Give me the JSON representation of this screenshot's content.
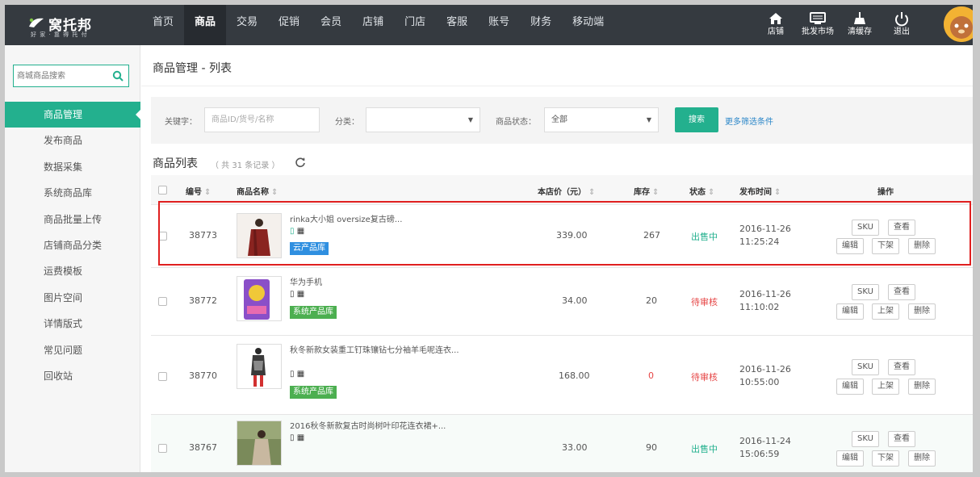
{
  "header": {
    "logo_name": "窝托邦",
    "logo_slogan": "好 家 · 靠 得 托 付",
    "nav": [
      {
        "label": "首页",
        "active": false
      },
      {
        "label": "商品",
        "active": true
      },
      {
        "label": "交易",
        "active": false
      },
      {
        "label": "促销",
        "active": false
      },
      {
        "label": "会员",
        "active": false
      },
      {
        "label": "店铺",
        "active": false
      },
      {
        "label": "门店",
        "active": false
      },
      {
        "label": "客服",
        "active": false
      },
      {
        "label": "账号",
        "active": false
      },
      {
        "label": "财务",
        "active": false
      },
      {
        "label": "移动端",
        "active": false
      }
    ],
    "tools": [
      {
        "label": "店铺",
        "icon": "home-icon"
      },
      {
        "label": "批发市场",
        "icon": "monitor-icon"
      },
      {
        "label": "清缓存",
        "icon": "broom-icon"
      },
      {
        "label": "退出",
        "icon": "power-icon"
      }
    ]
  },
  "sidebar": {
    "search_placeholder": "商城商品搜索",
    "items": [
      {
        "label": "商品管理",
        "active": true
      },
      {
        "label": "发布商品",
        "active": false
      },
      {
        "label": "数据采集",
        "active": false
      },
      {
        "label": "系统商品库",
        "active": false
      },
      {
        "label": "商品批量上传",
        "active": false
      },
      {
        "label": "店铺商品分类",
        "active": false
      },
      {
        "label": "运费模板",
        "active": false
      },
      {
        "label": "图片空间",
        "active": false
      },
      {
        "label": "详情版式",
        "active": false
      },
      {
        "label": "常见问题",
        "active": false
      },
      {
        "label": "回收站",
        "active": false
      }
    ]
  },
  "main": {
    "title": "商品管理 - 列表",
    "filter": {
      "keyword_label": "关键字：",
      "keyword_placeholder": "商品ID/货号/名称",
      "category_label": "分类：",
      "category_value": "",
      "status_label": "商品状态：",
      "status_value": "全部",
      "search_button": "搜索",
      "more_filters": "更多筛选条件"
    },
    "list_title": "商品列表",
    "list_count": "（ 共 31 条记录 ）",
    "columns": {
      "id": "编号",
      "name": "商品名称",
      "price": "本店价（元）",
      "stock": "库存",
      "status": "状态",
      "time": "发布时间",
      "ops": "操作"
    },
    "rows": [
      {
        "id": "38773",
        "name": "rinka大小姐 oversize复古磅...",
        "tag": "云产品库",
        "price": "339.00",
        "stock": "267",
        "status": "出售中",
        "date": "2016-11-26",
        "time": "11:25:24",
        "ops": [
          "SKU",
          "查看",
          "编辑",
          "下架",
          "删除"
        ]
      },
      {
        "id": "38772",
        "name": "华为手机",
        "tag": "系统产品库",
        "price": "34.00",
        "stock": "20",
        "status": "待审核",
        "date": "2016-11-26",
        "time": "11:10:02",
        "ops": [
          "SKU",
          "查看",
          "编辑",
          "上架",
          "删除"
        ]
      },
      {
        "id": "38770",
        "name": "秋冬新款女装重工钉珠镶钻七分袖羊毛呢连衣...",
        "tag": "系统产品库",
        "price": "168.00",
        "stock": "0",
        "status": "待审核",
        "date": "2016-11-26",
        "time": "10:55:00",
        "ops": [
          "SKU",
          "查看",
          "编辑",
          "上架",
          "删除"
        ]
      },
      {
        "id": "38767",
        "name": "2016秋冬新款复古时尚树叶印花连衣裙+...",
        "tag": "",
        "price": "33.00",
        "stock": "90",
        "status": "出售中",
        "date": "2016-11-24",
        "time": "15:06:59",
        "ops": [
          "SKU",
          "查看",
          "编辑",
          "下架",
          "删除"
        ]
      }
    ]
  },
  "colors": {
    "accent": "#23b08e",
    "topbar": "#353a40",
    "tag_cloud": "#2f8fe0",
    "tag_system": "#4caf50",
    "status_pending": "#e64545",
    "highlight": "#e02020"
  }
}
